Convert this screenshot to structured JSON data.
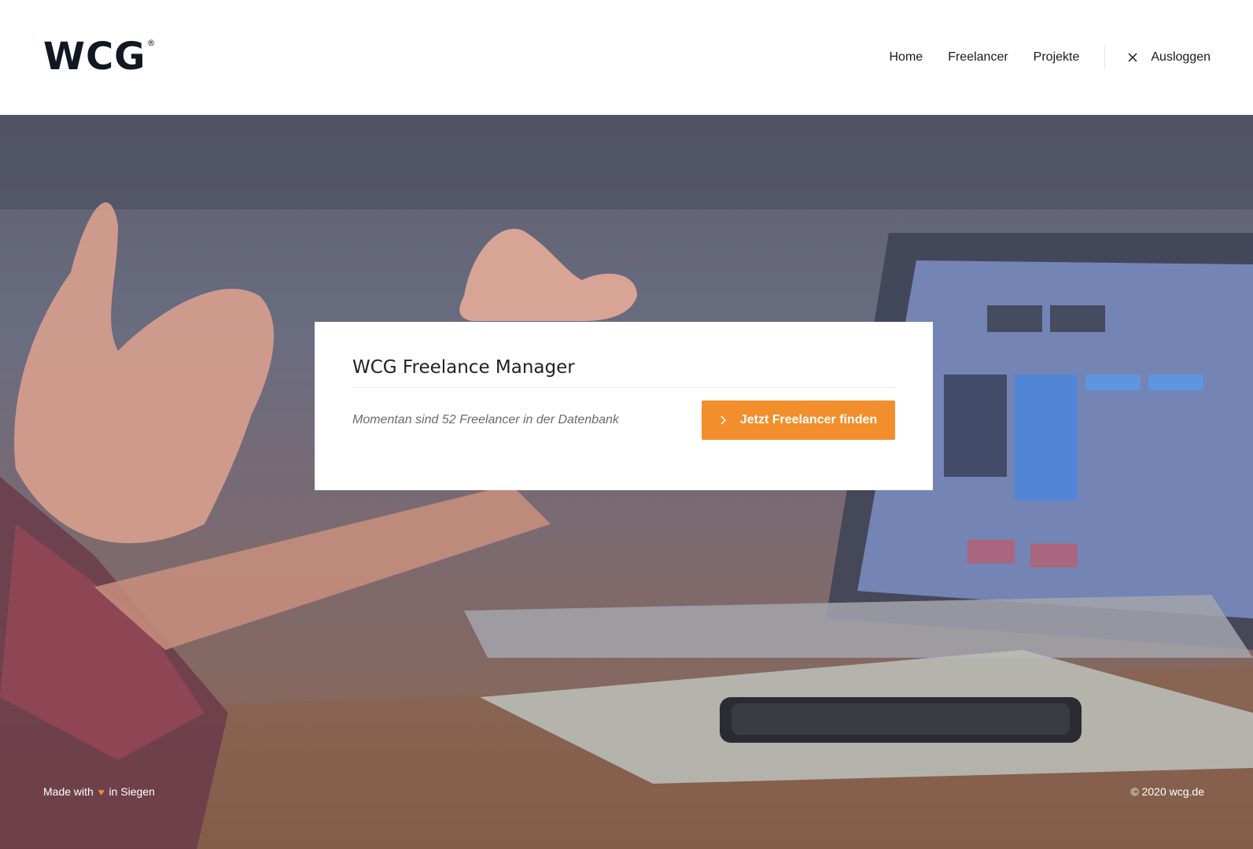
{
  "header": {
    "logo_text": "WCG",
    "logo_mark": "®",
    "nav": [
      {
        "label": "Home"
      },
      {
        "label": "Freelancer"
      },
      {
        "label": "Projekte"
      }
    ],
    "logout_label": "Ausloggen",
    "logout_icon": "close-icon"
  },
  "card": {
    "title": "WCG Freelance Manager",
    "text": "Momentan sind 52 Freelancer in der Datenbank",
    "button_label": "Jetzt Freelancer finden",
    "button_icon": "chevron-right-icon"
  },
  "footer": {
    "made_with": "Made with",
    "heart_icon": "heart-icon",
    "location": "in Siegen",
    "copyright": "© 2020 wcg.de"
  },
  "colors": {
    "accent": "#f28f2c",
    "text_dark": "#111821",
    "hero_overlay": "#5d5f6f"
  }
}
